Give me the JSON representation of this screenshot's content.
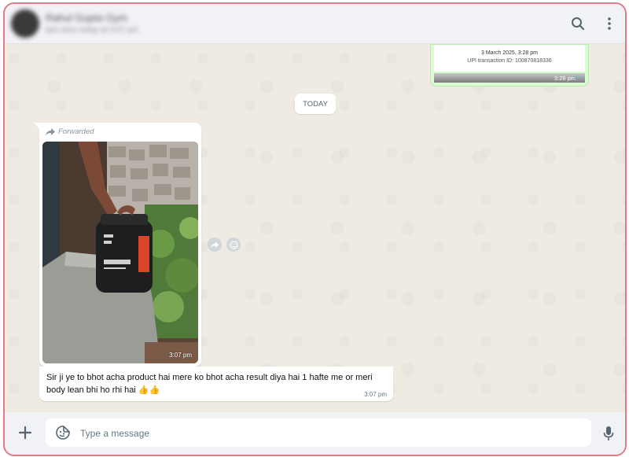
{
  "header": {
    "contact_name": "Rahul Gupta Gym",
    "contact_status": "last seen today at 3:07 pm",
    "icons": [
      "search-icon",
      "menu-icon"
    ]
  },
  "chat": {
    "outgoing_payment": {
      "date": "3 March 2025, 3:28 pm",
      "transaction": "UPI transaction ID: 100870818336",
      "time": "3:28 pm"
    },
    "date_divider": "TODAY",
    "forwarded_media": {
      "forwarded_label": "Forwarded",
      "photo_time": "3:07 pm"
    },
    "text_message": {
      "text": "Sir ji ye to bhot acha product hai mere ko bhot acha result diya hai 1 hafte me or meri body lean bhi ho rhi hai 👍👍",
      "time": "3:07 pm"
    }
  },
  "footer": {
    "placeholder": "Type a message"
  },
  "colors": {
    "border_accent": "#e07a85",
    "chat_bg": "#efeae2",
    "outgoing_bubble": "#d9fdd3",
    "read_ticks": "#53bdeb"
  }
}
